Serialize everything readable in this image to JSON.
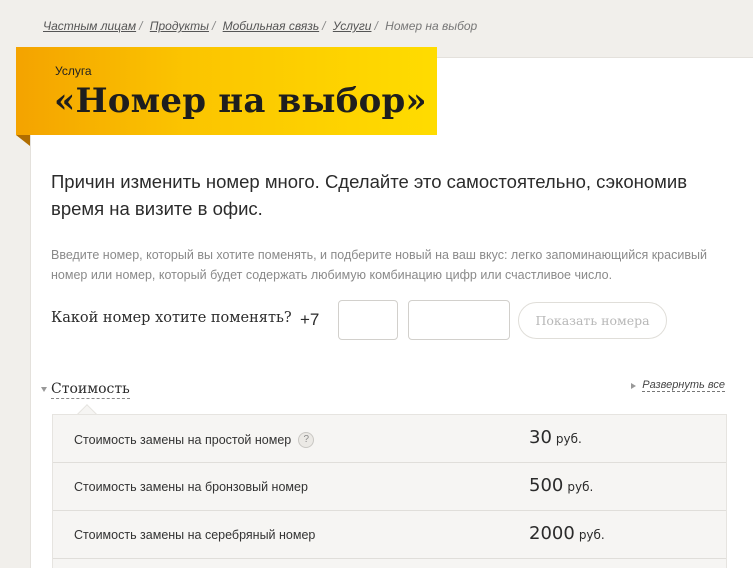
{
  "breadcrumb": {
    "items": [
      {
        "label": "Частным лицам"
      },
      {
        "label": "Продукты"
      },
      {
        "label": "Мобильная связь"
      },
      {
        "label": "Услуги"
      }
    ],
    "current": "Номер на выбор",
    "separator": "/"
  },
  "banner": {
    "kicker": "Услуга",
    "title": "«Номер на выбор»",
    "gradient_colors": [
      "#f4a300",
      "#ffdc00"
    ]
  },
  "lead": "Причин изменить номер много. Сделайте это самостоятельно, сэкономив время на визите в офис.",
  "description": "Введите номер, который вы хотите поменять, и подберите новый на ваш вкус: легко запоминающийся красивый номер или номер, который будет содержать любимую комбинацию цифр или счастливое число.",
  "form": {
    "label": "Какой номер хотите поменять?",
    "prefix": "+7",
    "code_value": "",
    "number_value": "",
    "submit_label": "Показать номера"
  },
  "cost": {
    "title": "Стоимость",
    "expand_all": "Развернуть все",
    "help_glyph": "?",
    "rows": [
      {
        "name": "Стоимость замены на простой номер",
        "price": "30",
        "unit": "руб.",
        "has_help": true
      },
      {
        "name": "Стоимость замены на бронзовый номер",
        "price": "500",
        "unit": "руб.",
        "has_help": false
      },
      {
        "name": "Стоимость замены на серебряный номер",
        "price": "2000",
        "unit": "руб.",
        "has_help": false
      }
    ]
  }
}
